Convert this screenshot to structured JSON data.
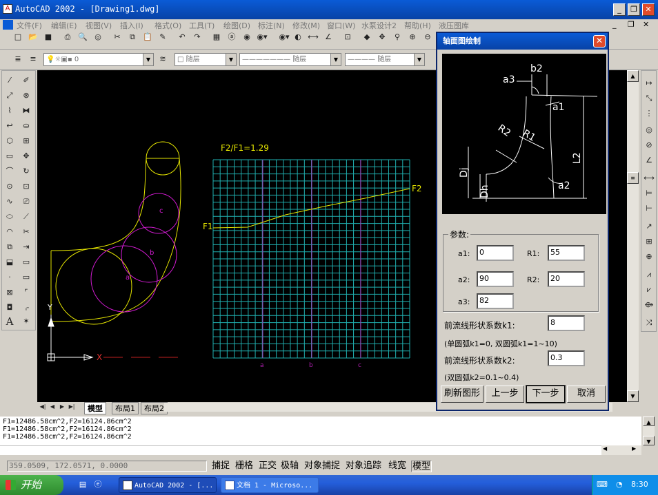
{
  "app": {
    "title": "AutoCAD 2002 - [Drawing1.dwg]"
  },
  "menu": [
    "文件(F)",
    "编辑(E)",
    "视图(V)",
    "插入(I)",
    "格式(O)",
    "工具(T)",
    "绘图(D)",
    "标注(N)",
    "修改(M)",
    "窗口(W)",
    "水泵设计2",
    "帮助(H)",
    "液压图库"
  ],
  "layer": {
    "current": "0",
    "color": "随层",
    "linetype": "随层",
    "lineweight": "随层"
  },
  "drawing": {
    "ratio_label": "F2/F1=1.29",
    "f1": "F1",
    "f2": "F2",
    "grid_a": "a",
    "grid_b": "b",
    "grid_c": "c",
    "pt_a": "a",
    "pt_b": "b",
    "pt_c": "c",
    "axis_y": "Y",
    "axis_x": "X"
  },
  "tabs": [
    "模型",
    "布局1",
    "布局2"
  ],
  "command_history": [
    "F1=12486.58cm^2,F2=16124.86cm^2",
    "F1=12486.58cm^2,F2=16124.86cm^2",
    "F1=12486.58cm^2,F2=16124.86cm^2"
  ],
  "status": {
    "coords": "359.0509, 172.0571, 0.0000",
    "toggles": [
      "捕捉",
      "栅格",
      "正交",
      "极轴",
      "对象捕捉",
      "对象追踪",
      "线宽",
      "模型"
    ]
  },
  "taskbar": {
    "start": "开始",
    "tasks": [
      "AutoCAD 2002 - [...",
      "文档 1 - Microso..."
    ],
    "clock": "8:30"
  },
  "dialog": {
    "title": "轴面图绘制",
    "preview_labels": {
      "a3": "a3",
      "b2": "b2",
      "a1": "a1",
      "r2": "R2",
      "r1": "R1",
      "dj": "Dj",
      "dh": "Dh",
      "l2": "L2",
      "a2": "a2"
    },
    "group_label": "参数:",
    "fields": {
      "a1": {
        "label": "a1:",
        "value": "0"
      },
      "a2": {
        "label": "a2:",
        "value": "90"
      },
      "a3": {
        "label": "a3:",
        "value": "82"
      },
      "r1": {
        "label": "R1:",
        "value": "55"
      },
      "r2": {
        "label": "R2:",
        "value": "20"
      }
    },
    "k1_label": "前流线形状系数k1:",
    "k1_value": "8",
    "k1_hint": "(单圆弧k1=0, 双圆弧k1=1~10)",
    "k2_label": "前流线形状系数k2:",
    "k2_value": "0.3",
    "k2_hint": "(双圆弧k2=0.1~0.4)",
    "buttons": {
      "refresh": "刷新图形",
      "prev": "上一步",
      "next": "下一步",
      "cancel": "取消"
    }
  }
}
